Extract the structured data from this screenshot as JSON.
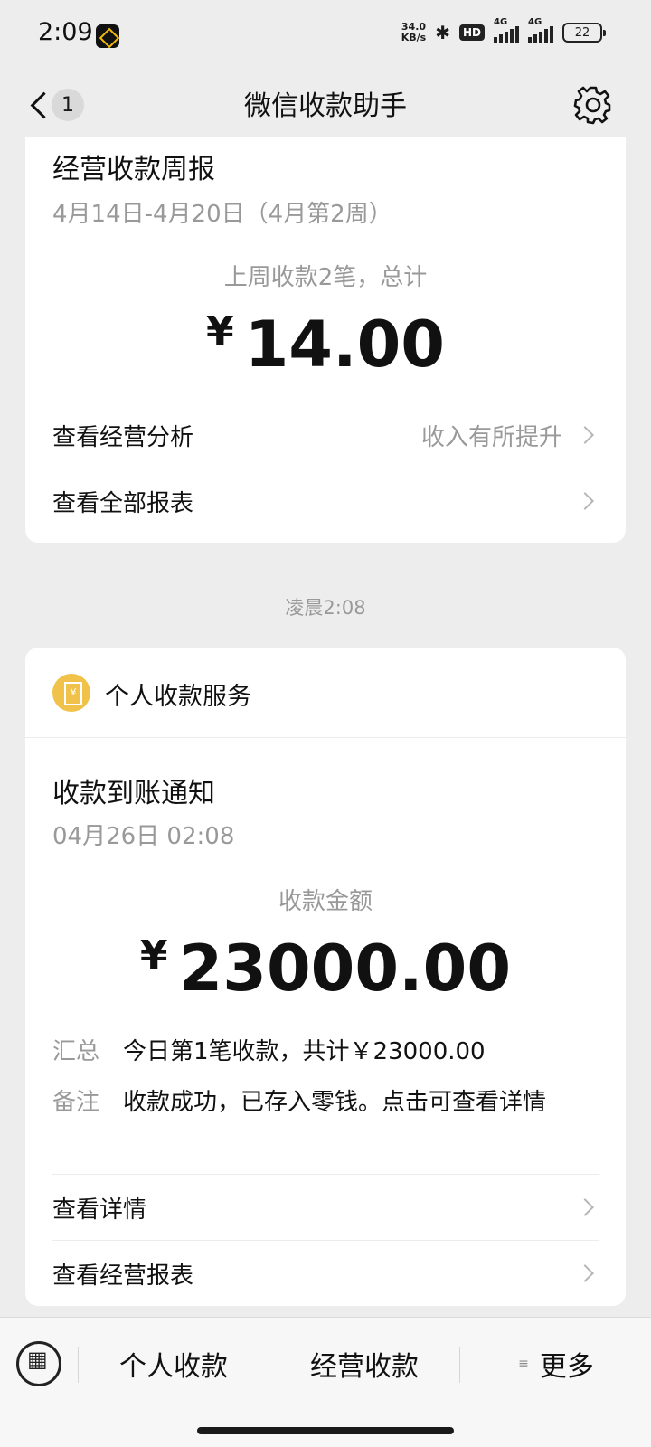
{
  "status_bar": {
    "time": "2:09",
    "net_speed_value": "34.0",
    "net_speed_unit": "KB/s",
    "hd": "HD",
    "network1": "4G",
    "network2": "4G",
    "battery": "22"
  },
  "header": {
    "unread_count": "1",
    "title": "微信收款助手"
  },
  "weekly_card": {
    "title": "经营收款周报",
    "date_range": "4月14日-4月20日（4月第2周）",
    "summary": "上周收款2笔，总计",
    "currency": "¥",
    "amount": "14.00",
    "rows": [
      {
        "label": "查看经营分析",
        "right_text": "收入有所提升"
      },
      {
        "label": "查看全部报表",
        "right_text": ""
      }
    ]
  },
  "timestamp": "凌晨2:08",
  "notice_card": {
    "service_name": "个人收款服务",
    "title": "收款到账通知",
    "datetime": "04月26日 02:08",
    "amount_label": "收款金额",
    "currency": "¥",
    "amount": "23000.00",
    "details": [
      {
        "key": "汇总",
        "value": "今日第1笔收款，共计￥23000.00"
      },
      {
        "key": "备注",
        "value": "收款成功，已存入零钱。点击可查看详情"
      }
    ],
    "rows": [
      {
        "label": "查看详情"
      },
      {
        "label": "查看经营报表"
      }
    ]
  },
  "bottom_menu": {
    "items": [
      "个人收款",
      "经营收款",
      "更多"
    ],
    "more_icon": "≡"
  }
}
